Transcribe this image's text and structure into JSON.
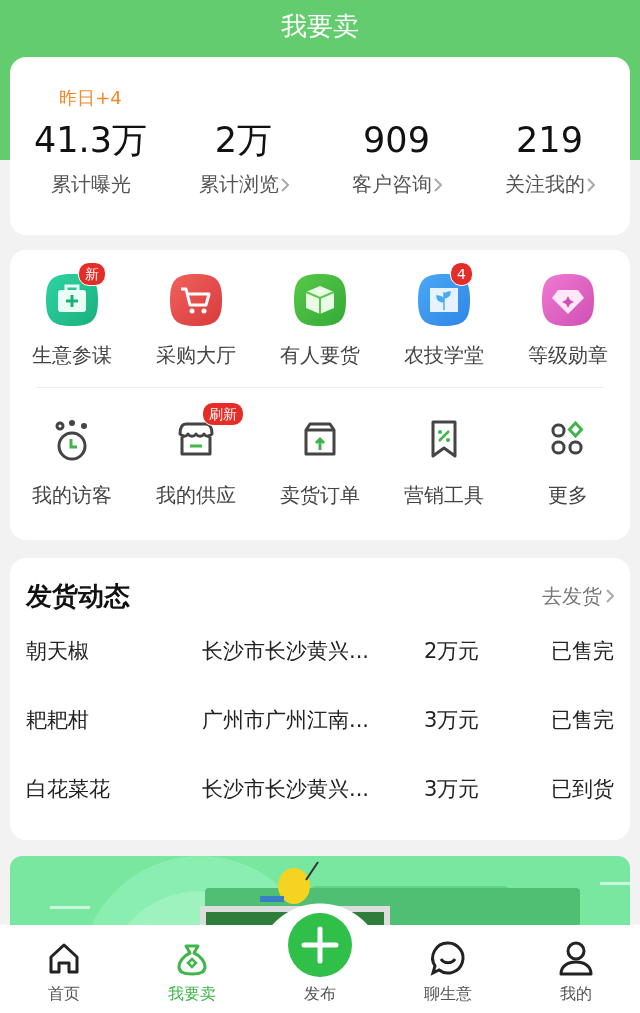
{
  "header": {
    "title": "我要卖"
  },
  "stats": [
    {
      "delta": "昨日+4",
      "value": "41.3万",
      "label": "累计曝光",
      "arrow": false
    },
    {
      "value": "2万",
      "label": "累计浏览",
      "arrow": true
    },
    {
      "value": "909",
      "label": "客户咨询",
      "arrow": true
    },
    {
      "value": "219",
      "label": "关注我的",
      "arrow": true
    }
  ],
  "tools": [
    {
      "label": "生意参谋",
      "kind": "color",
      "badge": "新"
    },
    {
      "label": "采购大厅",
      "kind": "color"
    },
    {
      "label": "有人要货",
      "kind": "color"
    },
    {
      "label": "农技学堂",
      "kind": "color",
      "badge": "4"
    },
    {
      "label": "等级勋章",
      "kind": "color"
    },
    {
      "label": "我的访客",
      "kind": "outline"
    },
    {
      "label": "我的供应",
      "kind": "outline",
      "badge": "刷新"
    },
    {
      "label": "卖货订单",
      "kind": "outline"
    },
    {
      "label": "营销工具",
      "kind": "outline"
    },
    {
      "label": "更多",
      "kind": "outline"
    }
  ],
  "shipments": {
    "title": "发货动态",
    "link": "去发货",
    "rows": [
      {
        "product": "朝天椒",
        "location": "长沙市长沙黄兴...",
        "amount": "2万元",
        "status": "已售完"
      },
      {
        "product": "耙耙柑",
        "location": "广州市广州江南...",
        "amount": "3万元",
        "status": "已售完"
      },
      {
        "product": "白花菜花",
        "location": "长沙市长沙黄兴...",
        "amount": "3万元",
        "status": "已到货"
      }
    ]
  },
  "tabbar": [
    {
      "label": "首页",
      "kind": "tab",
      "selected": false
    },
    {
      "label": "我要卖",
      "kind": "tab",
      "selected": true
    },
    {
      "label": "发布",
      "kind": "publish",
      "selected": false
    },
    {
      "label": "聊生意",
      "kind": "tab",
      "selected": false
    },
    {
      "label": "我的",
      "kind": "tab",
      "selected": false
    }
  ]
}
